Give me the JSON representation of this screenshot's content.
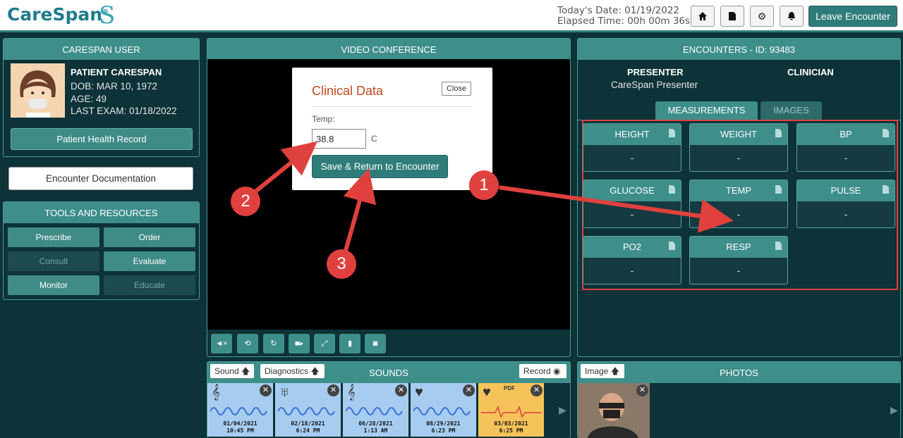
{
  "header": {
    "logo": "CareSpan",
    "logo_mark": "®",
    "date_label": "Today's Date: 01/19/2022",
    "elapsed_label": "Elapsed Time: 00h 00m 36s",
    "leave_label": "Leave Encounter",
    "icons": [
      "home-icon",
      "document-icon",
      "gear-icon",
      "bell-icon"
    ]
  },
  "user_panel": {
    "title": "CARESPAN USER",
    "name": "PATIENT CARESPAN",
    "dob": "DOB: MAR 10, 1972",
    "age": "AGE: 49",
    "last_exam": "LAST EXAM: 01/18/2022",
    "phr_button": "Patient Health Record"
  },
  "encounter_doc": "Encounter Documentation",
  "tools": {
    "title": "TOOLS AND RESOURCES",
    "items": [
      {
        "label": "Prescribe",
        "enabled": true
      },
      {
        "label": "Order",
        "enabled": true
      },
      {
        "label": "Consult",
        "enabled": false
      },
      {
        "label": "Evaluate",
        "enabled": true
      },
      {
        "label": "Monitor",
        "enabled": true
      },
      {
        "label": "Educate",
        "enabled": false
      }
    ]
  },
  "video": {
    "title": "VIDEO CONFERENCE",
    "controls": [
      "mute-icon",
      "camera-flip-icon",
      "refresh-icon",
      "video-camera-icon",
      "fullscreen-icon",
      "light-icon",
      "camera-icon"
    ]
  },
  "modal": {
    "title": "Clinical Data",
    "close": "Close",
    "field_label": "Temp:",
    "field_value": "38.8",
    "unit": "C",
    "save": "Save & Return to Encounter"
  },
  "encounters": {
    "title": "ENCOUNTERS - ID: 93483",
    "presenter_label": "PRESENTER",
    "presenter_name": "CareSpan Presenter",
    "clinician_label": "CLINICIAN",
    "tabs": [
      "MEASUREMENTS",
      "IMAGES"
    ],
    "active_tab": "MEASUREMENTS",
    "measurements": [
      {
        "label": "HEIGHT",
        "value": "-"
      },
      {
        "label": "WEIGHT",
        "value": "-"
      },
      {
        "label": "BP",
        "value": "-"
      },
      {
        "label": "GLUCOSE",
        "value": "-"
      },
      {
        "label": "TEMP",
        "value": "-"
      },
      {
        "label": "PULSE",
        "value": "-"
      },
      {
        "label": "PO2",
        "value": "-"
      },
      {
        "label": "RESP",
        "value": "-"
      }
    ]
  },
  "sounds": {
    "title": "SOUNDS",
    "sound_button": "Sound",
    "diagnostics_button": "Diagnostics",
    "record_button": "Record",
    "items": [
      {
        "icon": "ear-icon",
        "date": "01/04/2021",
        "time": "10:45 PM"
      },
      {
        "icon": "lungs-icon",
        "date": "02/18/2021",
        "time": "6:24 PM"
      },
      {
        "icon": "ear-icon",
        "date": "06/28/2021",
        "time": "1:13 AM"
      },
      {
        "icon": "heart-icon",
        "date": "08/29/2021",
        "time": "6:23 PM"
      },
      {
        "icon": "heart-icon",
        "date": "03/03/2021",
        "time": "6:25 PM",
        "badge": "PDF"
      }
    ]
  },
  "photos": {
    "title": "PHOTOS",
    "image_button": "Image"
  },
  "annotations": [
    "1",
    "2",
    "3"
  ],
  "colors": {
    "teal": "#3e8e8a",
    "background": "#0d3238",
    "accent": "#c0491e",
    "annotation": "#e0413e",
    "highlight_box": "#e0413e"
  }
}
